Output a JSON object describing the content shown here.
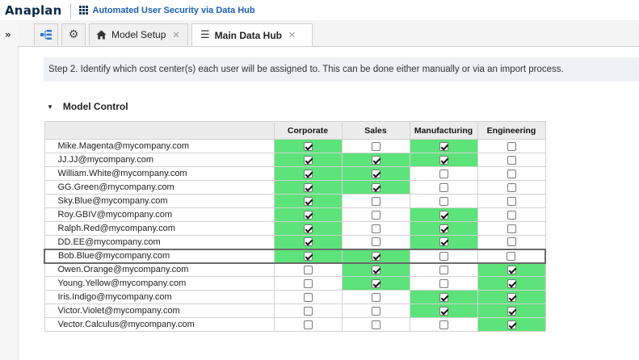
{
  "app": {
    "logo": "Anaplan",
    "title": "Automated User Security via Data Hub"
  },
  "rail": {
    "expand_glyph": "»"
  },
  "tabs": [
    {
      "label": "",
      "icon": "hierarchy-icon"
    },
    {
      "label": "",
      "icon": "gear-icon"
    },
    {
      "label": "Model Setup",
      "icon": "home-icon",
      "closable": true
    },
    {
      "label": "Main Data Hub",
      "icon": "menu-icon",
      "closable": true,
      "active": true
    }
  ],
  "main": {
    "step_text": "Step 2. Identify which cost center(s) each user will be assigned to. This can be done either manually or via an import process.",
    "section_title": "Model Control",
    "columns": [
      "Corporate",
      "Sales",
      "Manufacturing",
      "Engineering"
    ],
    "rows": [
      {
        "user": "Mike.Magenta@mycompany.com",
        "values": [
          true,
          false,
          true,
          false
        ]
      },
      {
        "user": "JJ.JJ@mycompany.com",
        "values": [
          true,
          true,
          true,
          false
        ]
      },
      {
        "user": "William.White@mycompany.com",
        "values": [
          true,
          true,
          false,
          false
        ]
      },
      {
        "user": "GG.Green@mycompany.com",
        "values": [
          true,
          true,
          false,
          false
        ]
      },
      {
        "user": "Sky.Blue@mycompany.com",
        "values": [
          true,
          false,
          false,
          false
        ]
      },
      {
        "user": "Roy.GBIV@mycompany.com",
        "values": [
          true,
          false,
          true,
          false
        ]
      },
      {
        "user": "Ralph.Red@mycompany.com",
        "values": [
          true,
          false,
          true,
          false
        ]
      },
      {
        "user": "DD.EE@mycompany.com",
        "values": [
          true,
          false,
          true,
          false
        ]
      },
      {
        "user": "Bob.Blue@mycompany.com",
        "values": [
          true,
          true,
          false,
          false
        ],
        "selected": true
      },
      {
        "user": "Owen.Orange@mycompany.com",
        "values": [
          false,
          true,
          false,
          true
        ]
      },
      {
        "user": "Young.Yellow@mycompany.com",
        "values": [
          false,
          true,
          false,
          true
        ]
      },
      {
        "user": "Iris.Indigo@mycompany.com",
        "values": [
          false,
          false,
          true,
          true
        ]
      },
      {
        "user": "Victor.Violet@mycompany.com",
        "values": [
          false,
          false,
          true,
          true
        ]
      },
      {
        "user": "Vector.Calculus@mycompany.com",
        "values": [
          false,
          false,
          false,
          true
        ]
      }
    ]
  },
  "colors": {
    "checked_cell": "#5ce37a",
    "title_link": "#1a5fb0"
  }
}
